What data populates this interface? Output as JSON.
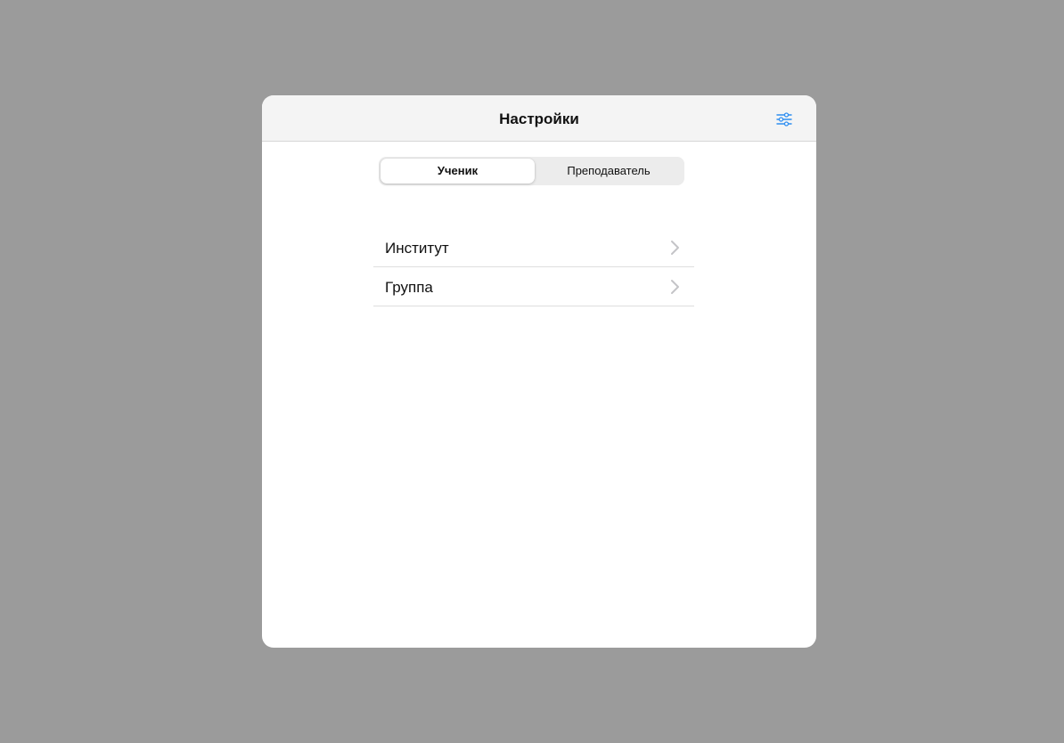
{
  "navbar": {
    "title": "Настройки",
    "filter_icon": "sliders-icon",
    "accent_color": "#2f8ef0"
  },
  "segmented_control": {
    "selected": "Ученик",
    "options": [
      "Ученик",
      "Преподаватель"
    ]
  },
  "settings_list": {
    "items": [
      {
        "label": "Институт",
        "icon": "chevron-right-icon"
      },
      {
        "label": "Группа",
        "icon": "chevron-right-icon"
      }
    ]
  }
}
